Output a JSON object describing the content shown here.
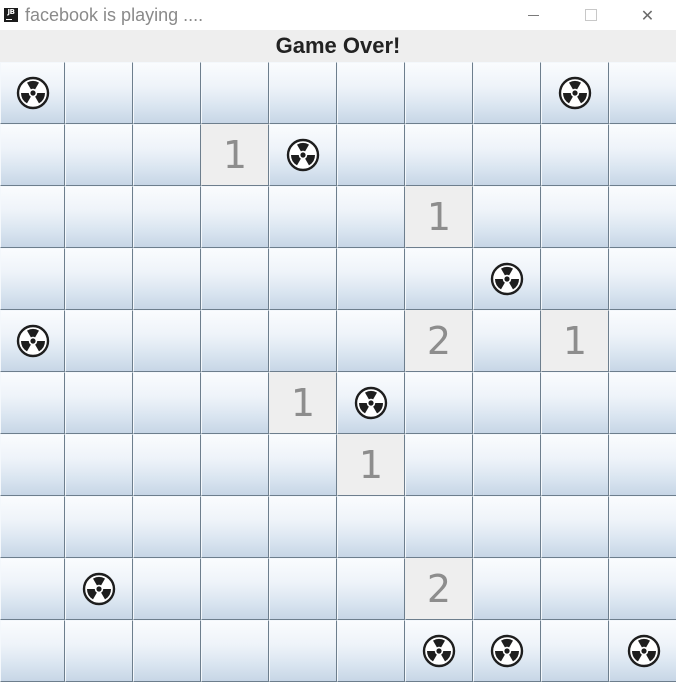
{
  "window": {
    "title": "facebook is playing ....",
    "icon": "jetbrains-icon",
    "icon_text": "JB",
    "controls": [
      "minimize",
      "maximize",
      "close"
    ],
    "close_glyph": "✕"
  },
  "status": {
    "text": "Game Over!"
  },
  "board": {
    "rows": 10,
    "cols": 10,
    "cells": [
      [
        "M",
        "",
        "",
        "",
        "",
        "",
        "",
        "",
        "M",
        ""
      ],
      [
        "",
        "",
        "",
        "1",
        "M",
        "",
        "",
        "",
        "",
        ""
      ],
      [
        "",
        "",
        "",
        "",
        "",
        "",
        "1",
        "",
        "",
        ""
      ],
      [
        "",
        "",
        "",
        "",
        "",
        "",
        "",
        "M",
        "",
        ""
      ],
      [
        "M",
        "",
        "",
        "",
        "",
        "",
        "2",
        "",
        "1",
        ""
      ],
      [
        "",
        "",
        "",
        "",
        "1",
        "M",
        "",
        "",
        "",
        ""
      ],
      [
        "",
        "",
        "",
        "",
        "",
        "1",
        "",
        "",
        "",
        ""
      ],
      [
        "",
        "",
        "",
        "",
        "",
        "",
        "",
        "",
        "",
        ""
      ],
      [
        "",
        "M",
        "",
        "",
        "",
        "",
        "2",
        "",
        "",
        ""
      ],
      [
        "",
        "",
        "",
        "",
        "",
        "",
        "M",
        "M",
        "",
        "M"
      ]
    ]
  },
  "colors": {
    "number": "#8d8d8d",
    "grid_line": "#6d7e8d",
    "mine": "#1e1e1e"
  }
}
